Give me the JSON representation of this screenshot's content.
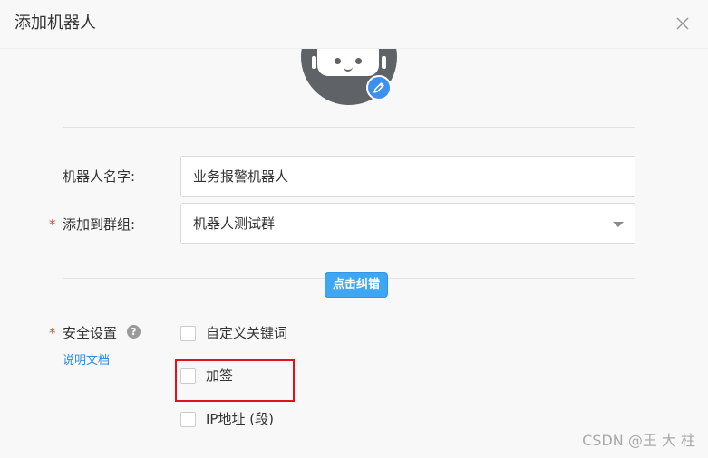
{
  "dialog": {
    "title": "添加机器人",
    "close_icon": "close-icon"
  },
  "avatar": {
    "icon": "robot-icon",
    "edit_icon": "pencil-icon"
  },
  "form": {
    "name_label": "机器人名字:",
    "name_value": "业务报警机器人",
    "group_required": "*",
    "group_label": "添加到群组:",
    "group_value": "机器人测试群",
    "fix_button": "点击纠错",
    "security_required": "*",
    "security_label": "安全设置",
    "help_icon": "?",
    "doc_link": "说明文档",
    "options": [
      {
        "label": "自定义关键词",
        "checked": false
      },
      {
        "label": "加签",
        "checked": false
      },
      {
        "label": "IP地址 (段)",
        "checked": false
      }
    ]
  },
  "annotation": {
    "highlight_color": "#e0121c"
  },
  "watermark": "CSDN @王 大 柱",
  "colors": {
    "accent": "#3ea6f2",
    "link": "#2a8ce8",
    "required": "#f03c3c",
    "avatar_bg": "#5f6368"
  }
}
